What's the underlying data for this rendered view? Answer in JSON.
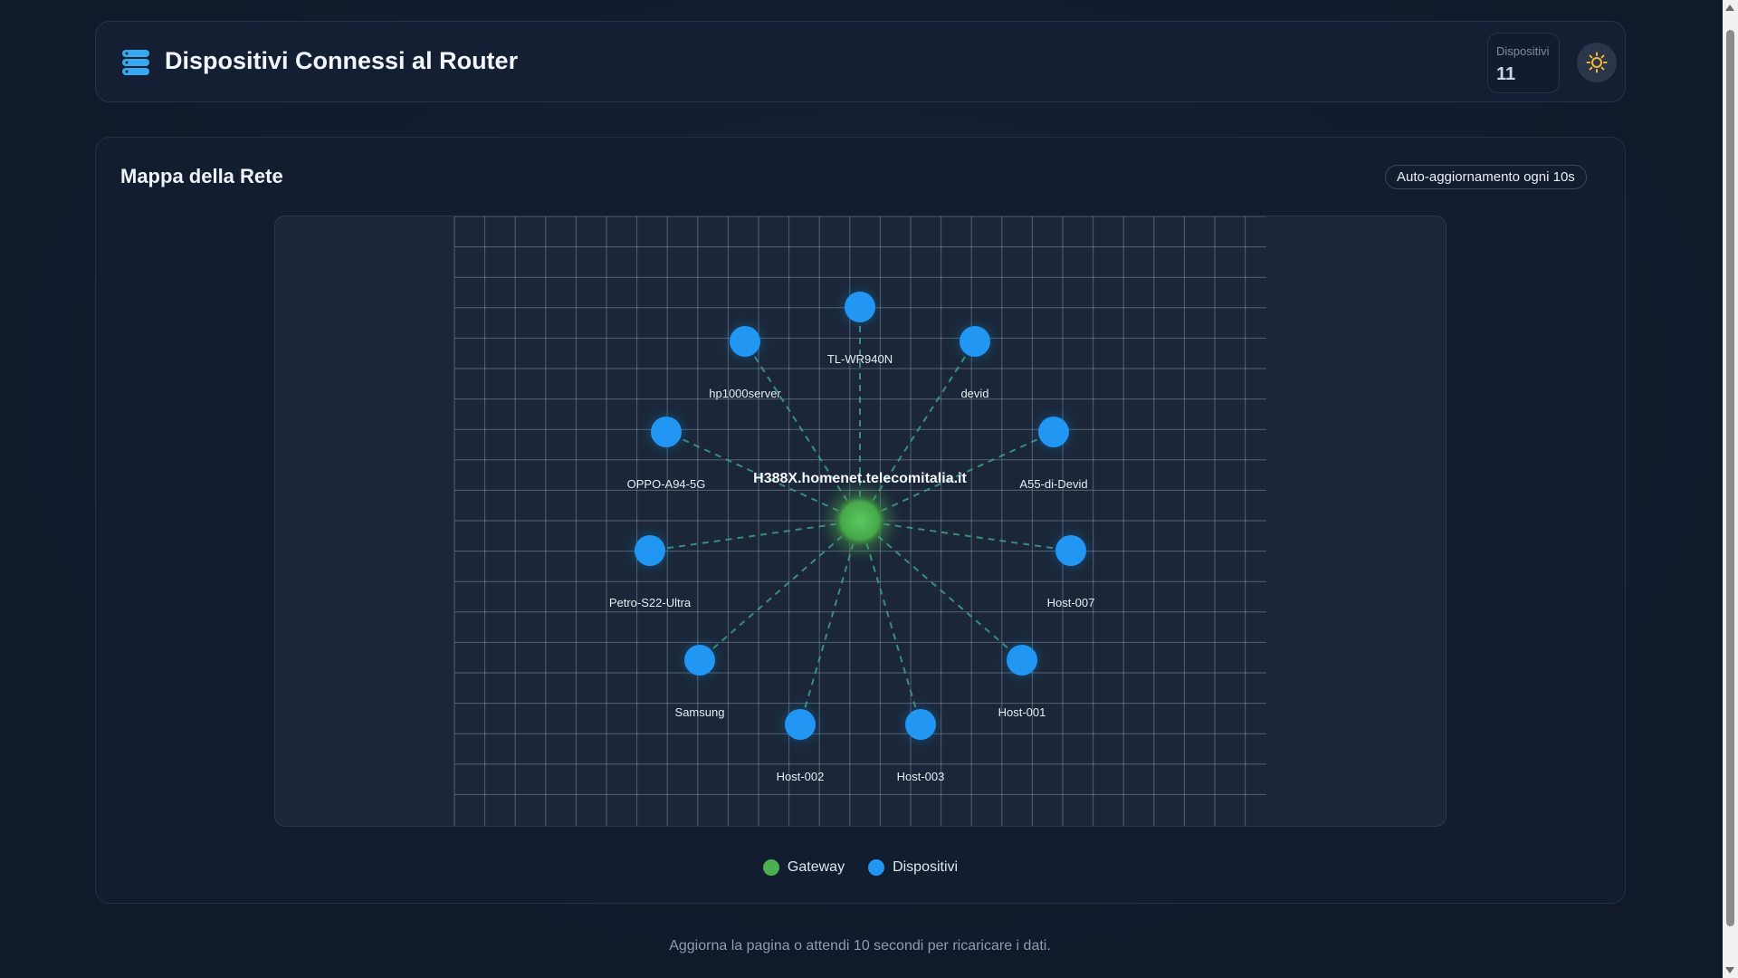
{
  "header": {
    "title": "Dispositivi Connessi al Router",
    "logo_icon": "server-stack-icon",
    "counter_label": "Dispositivi",
    "counter_value": "11",
    "theme_icon": "sun-icon"
  },
  "map": {
    "title": "Mappa della Rete",
    "auto_refresh_badge": "Auto-aggiornamento ogni 10s",
    "gateway": {
      "name": "H388X.homenet.telecomitalia.it",
      "color": "#4caf50"
    },
    "device_color": "#2196f3",
    "devices": [
      {
        "name": "TL-WR940N"
      },
      {
        "name": "devid"
      },
      {
        "name": "A55-di-Devid"
      },
      {
        "name": "Host-007"
      },
      {
        "name": "Host-001"
      },
      {
        "name": "Host-003"
      },
      {
        "name": "Host-002"
      },
      {
        "name": "Samsung"
      },
      {
        "name": "Petro-S22-Ultra"
      },
      {
        "name": "OPPO-A94-5G"
      },
      {
        "name": "hp1000server"
      }
    ]
  },
  "legend": {
    "gateway_label": "Gateway",
    "devices_label": "Dispositivi"
  },
  "footer": {
    "text": "Aggiorna la pagina o attendi 10 secondi per ricaricare i dati."
  }
}
